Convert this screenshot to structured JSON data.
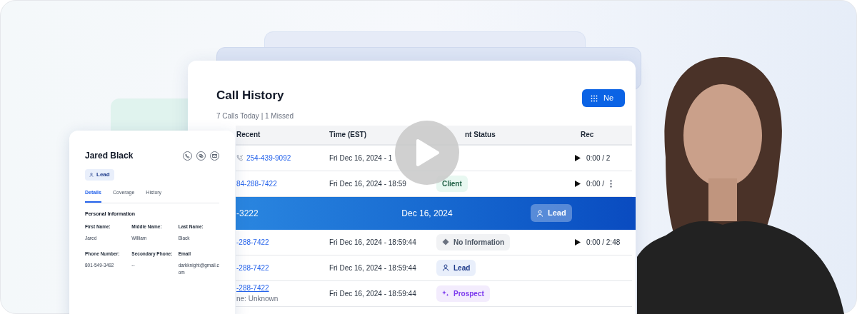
{
  "contact_card": {
    "name": "Jared Black",
    "badge": {
      "label": "Lead"
    },
    "tabs": [
      {
        "label": "Details",
        "selected": true
      },
      {
        "label": "Coverage",
        "selected": false
      },
      {
        "label": "History",
        "selected": false
      }
    ],
    "section_title": "Personal Information",
    "fields": [
      {
        "label": "First Name:",
        "value": "Jared"
      },
      {
        "label": "Middle Name:",
        "value": "William"
      },
      {
        "label": "Last Name:",
        "value": "Black"
      },
      {
        "label": "Phone Number:",
        "value": "801-549-3492"
      },
      {
        "label": "Secondary Phone:",
        "value": "--"
      },
      {
        "label": "Email",
        "value": "darkknight@gmail.com"
      }
    ]
  },
  "call_history": {
    "title": "Call History",
    "subtitle": "7 Calls Today | 1 Missed",
    "button": "Ne",
    "columns": [
      "Recent",
      "Time (EST)",
      "nt Status",
      "Rec"
    ],
    "rows": [
      {
        "selected": false,
        "incoming": true,
        "phone": "254-439-9092",
        "time": "Fri Dec 16, 2024 - 1",
        "recording": "0:00 / 2",
        "menu": false
      },
      {
        "selected": false,
        "incoming": false,
        "phone": "84-288-7422",
        "time": "Fri Dec 16, 2024 - 18:59",
        "status": {
          "kind": "client",
          "label": "Client"
        },
        "recording": "0:00 / ",
        "menu": true
      },
      {
        "selected": true,
        "phone": "-3222",
        "time": "Dec 16, 2024",
        "status": {
          "kind": "lead",
          "label": "Lead"
        }
      },
      {
        "selected": false,
        "incoming": false,
        "phone": "-288-7422",
        "time": "Fri Dec 16, 2024 - 18:59:44",
        "status": {
          "kind": "none",
          "label": "No Information"
        },
        "recording": "0:00 / 2:48",
        "menu": false
      },
      {
        "selected": false,
        "incoming": false,
        "phone": "-288-7422",
        "time": "Fri Dec 16, 2024 - 18:59:44",
        "status": {
          "kind": "lead",
          "label": "Lead"
        },
        "menu": false
      },
      {
        "selected": false,
        "incoming": false,
        "phone": "-288-7422",
        "note": "ne: Unknown",
        "time": "Fri Dec 16, 2024 - 18:59:44",
        "status": {
          "kind": "prospect",
          "label": "Prospect"
        },
        "menu": false
      }
    ]
  }
}
